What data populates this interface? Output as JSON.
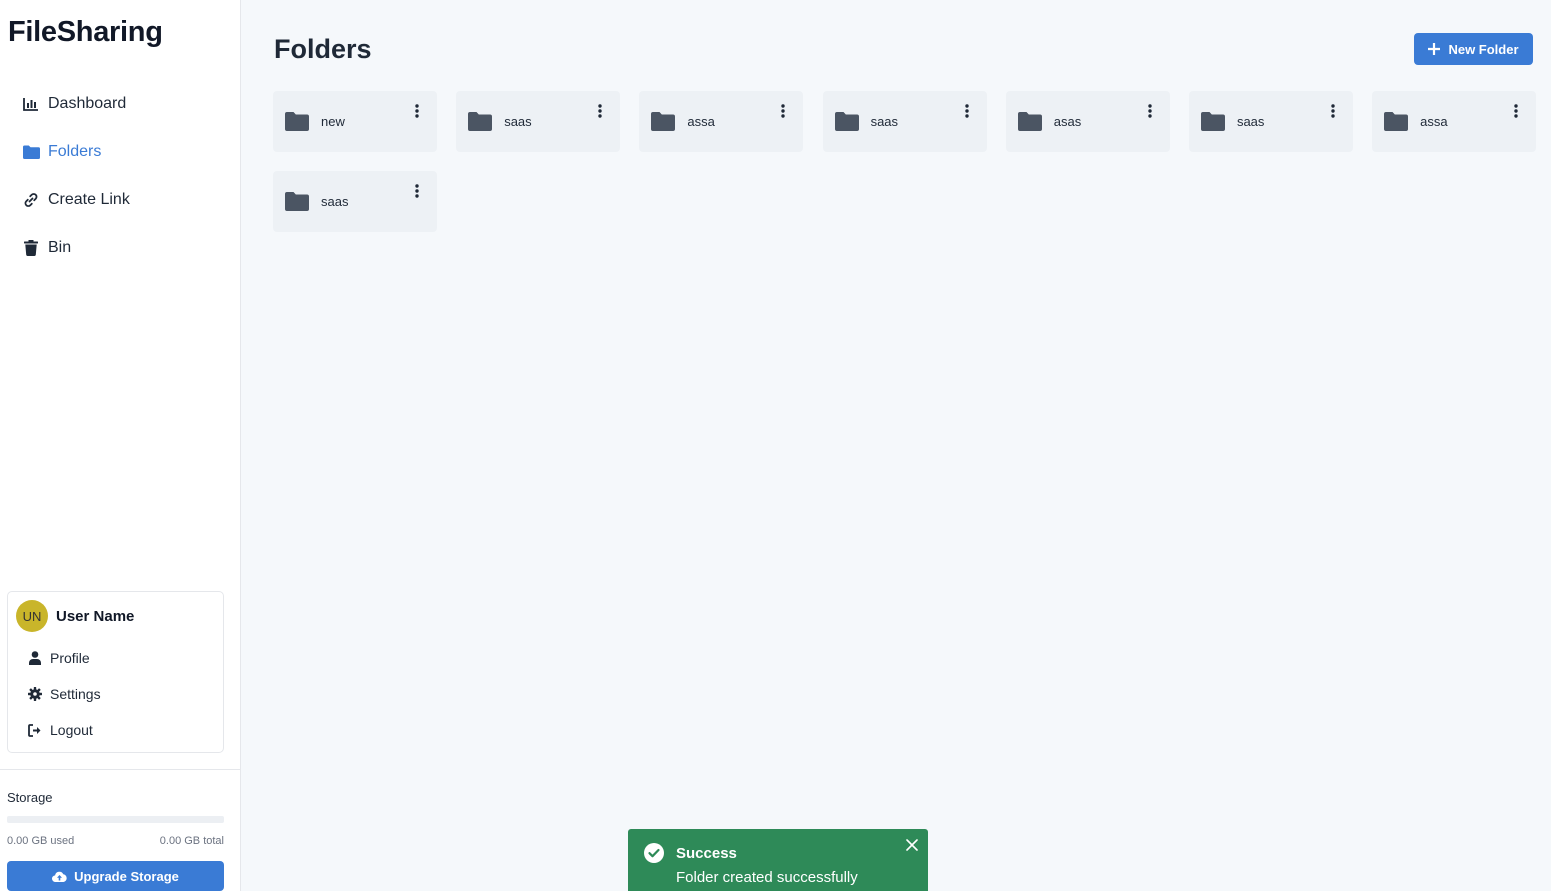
{
  "app": {
    "title": "FileSharing"
  },
  "sidebar": {
    "items": [
      {
        "label": "Dashboard",
        "icon": "chart-bar-icon",
        "active": false
      },
      {
        "label": "Folders",
        "icon": "folder-icon",
        "active": true
      },
      {
        "label": "Create Link",
        "icon": "link-icon",
        "active": false
      },
      {
        "label": "Bin",
        "icon": "trash-icon",
        "active": false
      }
    ]
  },
  "user": {
    "initials": "UN",
    "name": "User Name",
    "menu": [
      {
        "label": "Profile",
        "icon": "user-icon"
      },
      {
        "label": "Settings",
        "icon": "gear-icon"
      },
      {
        "label": "Logout",
        "icon": "logout-icon"
      }
    ]
  },
  "storage": {
    "title": "Storage",
    "used": "0.00 GB used",
    "total": "0.00 GB total",
    "used_fraction": 0,
    "upgrade_label": "Upgrade Storage"
  },
  "main": {
    "title": "Folders",
    "new_folder_label": "New Folder",
    "folders": [
      "new",
      "saas",
      "assa",
      "saas",
      "asas",
      "saas",
      "assa",
      "saas"
    ]
  },
  "toast": {
    "title": "Success",
    "message": "Folder created successfully"
  },
  "colors": {
    "accent": "#3a7bd5",
    "success": "#2e8a58",
    "avatar": "#c9b52a",
    "folder_icon": "#4b5563"
  }
}
